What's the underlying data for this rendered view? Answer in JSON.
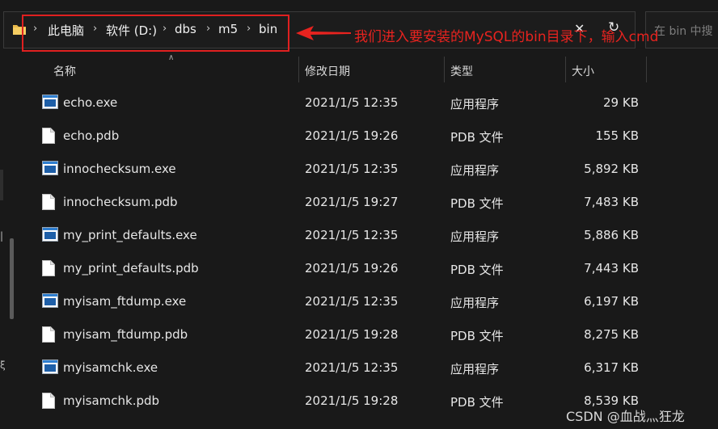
{
  "breadcrumb": {
    "items": [
      "此电脑",
      "软件 (D:)",
      "dbs",
      "m5",
      "bin"
    ]
  },
  "search": {
    "placeholder": "在 bin 中搜"
  },
  "annotation": {
    "text": "我们进入要安装的MySQL的bin目录下，输入cmd",
    "color": "#e8231f"
  },
  "left_pane": {
    "frag1": "|",
    "frag2": "ξ"
  },
  "columns": {
    "name": "名称",
    "date": "修改日期",
    "type": "类型",
    "size": "大小"
  },
  "files": [
    {
      "name": "echo.exe",
      "date": "2021/1/5 12:35",
      "type": "应用程序",
      "size": "29 KB",
      "icon": "exe-icon"
    },
    {
      "name": "echo.pdb",
      "date": "2021/1/5 19:26",
      "type": "PDB 文件",
      "size": "155 KB",
      "icon": "file-icon"
    },
    {
      "name": "innochecksum.exe",
      "date": "2021/1/5 12:35",
      "type": "应用程序",
      "size": "5,892 KB",
      "icon": "exe-icon"
    },
    {
      "name": "innochecksum.pdb",
      "date": "2021/1/5 19:27",
      "type": "PDB 文件",
      "size": "7,483 KB",
      "icon": "file-icon"
    },
    {
      "name": "my_print_defaults.exe",
      "date": "2021/1/5 12:35",
      "type": "应用程序",
      "size": "5,886 KB",
      "icon": "exe-icon"
    },
    {
      "name": "my_print_defaults.pdb",
      "date": "2021/1/5 19:26",
      "type": "PDB 文件",
      "size": "7,443 KB",
      "icon": "file-icon"
    },
    {
      "name": "myisam_ftdump.exe",
      "date": "2021/1/5 12:35",
      "type": "应用程序",
      "size": "6,197 KB",
      "icon": "exe-icon"
    },
    {
      "name": "myisam_ftdump.pdb",
      "date": "2021/1/5 19:28",
      "type": "PDB 文件",
      "size": "8,275 KB",
      "icon": "file-icon"
    },
    {
      "name": "myisamchk.exe",
      "date": "2021/1/5 12:35",
      "type": "应用程序",
      "size": "6,317 KB",
      "icon": "exe-icon"
    },
    {
      "name": "myisamchk.pdb",
      "date": "2021/1/5 19:28",
      "type": "PDB 文件",
      "size": "8,539 KB",
      "icon": "file-icon"
    }
  ],
  "watermark": "CSDN @血战灬狂龙",
  "colors": {
    "background": "#191919",
    "text": "#e6e6e6",
    "header_text": "#d8d8d8",
    "accent_folder": "#e8b84a",
    "exe_blue": "#2f7fd0"
  }
}
